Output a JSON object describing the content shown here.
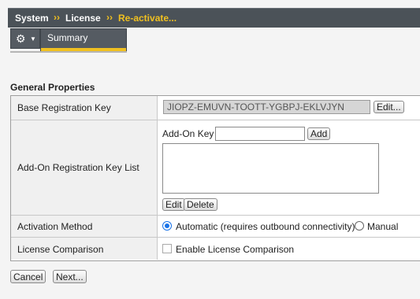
{
  "breadcrumb": {
    "items": [
      "System",
      "License",
      "Re-activate..."
    ],
    "separator": "››"
  },
  "tabs": {
    "summary_label": "Summary"
  },
  "general_properties": {
    "title": "General Properties",
    "base_registration": {
      "label": "Base Registration Key",
      "value": "JIOPZ-EMUVN-TOOTT-YGBPJ-EKLVJYN",
      "edit_button": "Edit..."
    },
    "addon": {
      "label": "Add-On Registration Key List",
      "key_label": "Add-On Key",
      "key_value": "",
      "add_button": "Add",
      "edit_button": "Edit",
      "delete_button": "Delete"
    },
    "activation": {
      "label": "Activation Method",
      "automatic_label": "Automatic (requires outbound connectivity)",
      "manual_label": "Manual",
      "selected": "automatic"
    },
    "license_comparison": {
      "label": "License Comparison",
      "checkbox_label": "Enable License Comparison",
      "checked": false
    }
  },
  "footer": {
    "cancel_button": "Cancel",
    "next_button": "Next..."
  },
  "colors": {
    "accent": "#f0c020",
    "header_bg": "#4b5258",
    "radio_selected": "#1a73e8"
  }
}
